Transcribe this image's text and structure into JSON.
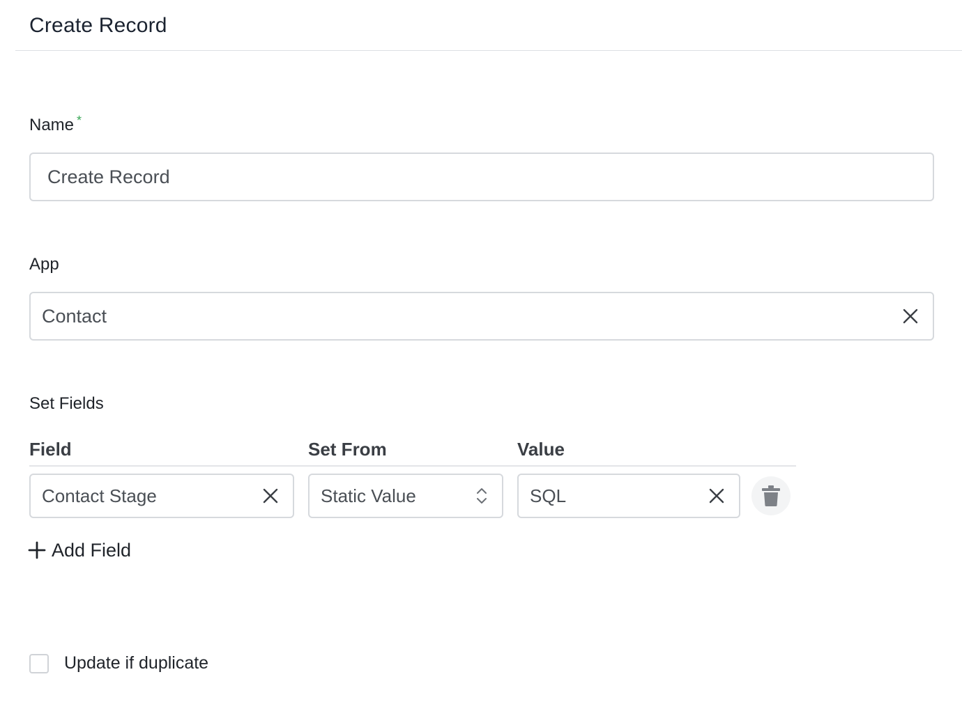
{
  "header": {
    "title": "Create Record"
  },
  "name_field": {
    "label": "Name",
    "required_mark": "*",
    "value": "Create Record"
  },
  "app_field": {
    "label": "App",
    "value": "Contact"
  },
  "set_fields": {
    "label": "Set Fields",
    "columns": [
      "Field",
      "Set From",
      "Value"
    ],
    "rows": [
      {
        "field": "Contact Stage",
        "set_from": "Static Value",
        "value": "SQL"
      }
    ],
    "add_label": "Add Field"
  },
  "update_duplicate": {
    "label": "Update if duplicate",
    "checked": false
  },
  "icons": {
    "clear": "close-icon",
    "stepper": "chevron-up-down-icon",
    "delete": "trash-icon",
    "add": "plus-icon"
  },
  "colors": {
    "required": "#3aa757",
    "border": "#d6d9dd",
    "icon": "#7d8187"
  }
}
